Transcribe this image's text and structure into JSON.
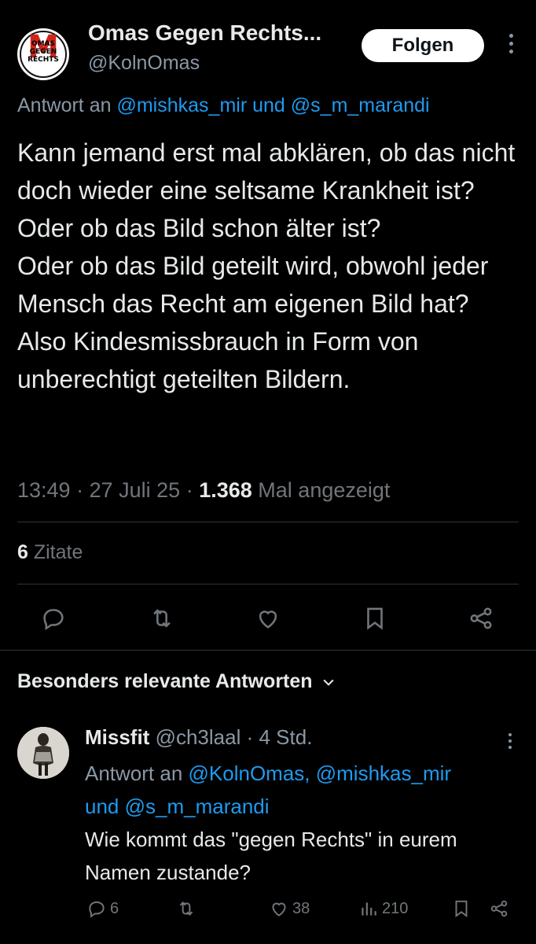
{
  "tweet": {
    "author_name": "Omas Gegen Rechts...",
    "author_handle": "@KolnOmas",
    "avatar_logo": {
      "m": "M",
      "line1": "OMAS",
      "line2": "GEGEN",
      "line3": "RECHTS"
    },
    "follow_label": "Folgen",
    "reply_prefix": "Antwort an",
    "reply_mention_1": "@mishkas_mir",
    "reply_and": "und",
    "reply_mention_2": "@s_m_marandi",
    "text_lines": [
      "Kann jemand erst mal abklären, ob das nicht doch wieder eine seltsame Krankheit ist?",
      "Oder ob das Bild schon älter ist?",
      "Oder ob das Bild geteilt wird, obwohl jeder Mensch das Recht am eigenen Bild hat?",
      "Also Kindesmissbrauch in Form von unberechtigt geteilten Bildern."
    ],
    "time": "13:49",
    "date": "27 Juli 25",
    "views_count": "1.368",
    "views_label": "Mal angezeigt",
    "quotes_count": "6",
    "quotes_label": "Zitate",
    "actions": [
      "reply-icon",
      "retweet-icon",
      "like-icon",
      "bookmark-icon",
      "share-icon"
    ]
  },
  "replies_section": {
    "title": "Besonders relevante Antworten"
  },
  "reply": {
    "author_name": "Missfit",
    "author_handle": "@ch3laal",
    "age": "4 Std.",
    "reply_prefix": "Antwort an",
    "mentions_line1": "@KolnOmas, @mishkas_mir",
    "reply_and": "und",
    "mention_last": "@s_m_marandi",
    "text": "Wie kommt das \"gegen Rechts\" in eurem Namen zustande?",
    "reply_count": "6",
    "like_count": "38",
    "view_count": "210"
  },
  "colors": {
    "background": "#000000",
    "text": "#e7e9ea",
    "muted": "#71767b",
    "link": "#1d9bf0",
    "divider": "#2f3336"
  }
}
